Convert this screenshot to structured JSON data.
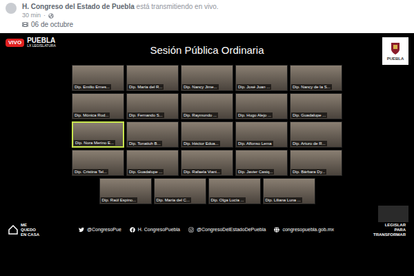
{
  "post": {
    "page": "H. Congreso del Estado de Puebla",
    "action": "está transmitiendo en vivo.",
    "time": "30 min",
    "separator": "·",
    "date": "06 de octubre"
  },
  "video": {
    "live_badge": "VIVO",
    "logo": {
      "name": "PUEBLA",
      "sub": "LX LEGISLATURA"
    },
    "title": "Sesión Pública Ordinaria",
    "crest_label": "PUEBLA",
    "participant_rows": [
      [
        {
          "name": "Dip. Emilio Ernes...",
          "speaking": false
        },
        {
          "name": "Dip. María del R...",
          "speaking": false
        },
        {
          "name": "Dip. Nancy Jime...",
          "speaking": false
        },
        {
          "name": "Dip. José Juan ...",
          "speaking": false
        },
        {
          "name": "Dip. Nancy de la S...",
          "speaking": false
        }
      ],
      [
        {
          "name": "Dip. Mónica Rod...",
          "speaking": false
        },
        {
          "name": "Dip. Fernando S...",
          "speaking": false
        },
        {
          "name": "Dip. Raymundo ...",
          "speaking": false
        },
        {
          "name": "Dip. Hugo Alejo ...",
          "speaking": false
        },
        {
          "name": "Dip. Guadalupe ...",
          "speaking": false
        }
      ],
      [
        {
          "name": "Dip. Nora Merino E...",
          "speaking": true
        },
        {
          "name": "Dip. Tonatiuh B...",
          "speaking": false
        },
        {
          "name": "Dip. Héctor Edua...",
          "speaking": false
        },
        {
          "name": "Dip. Alfonso Lema",
          "speaking": false
        },
        {
          "name": "Dip. Arturo de R...",
          "speaking": false
        }
      ],
      [
        {
          "name": "Dip. Cristina Tel...",
          "speaking": false
        },
        {
          "name": "Dip. Guadalupe ...",
          "speaking": false
        },
        {
          "name": "Dip. Rafaela Viani...",
          "speaking": false
        },
        {
          "name": "Dip. Javier Casiq...",
          "speaking": false
        },
        {
          "name": "Dip. Bárbara Dy...",
          "speaking": false
        }
      ],
      [
        {
          "name": "Dip. Raúl Espino...",
          "speaking": false
        },
        {
          "name": "Dip. María del C...",
          "speaking": false
        },
        {
          "name": "Dip. Olga Lucía ...",
          "speaking": false
        },
        {
          "name": "Dip. Liliana Luna ...",
          "speaking": false
        }
      ]
    ],
    "footer": {
      "campaign": [
        "ME",
        "QUEDO",
        "EN CASA"
      ],
      "links": [
        {
          "kind": "twitter",
          "label": "@CongresoPue"
        },
        {
          "kind": "facebook",
          "label": "H. CongresoPuebla"
        },
        {
          "kind": "instagram",
          "label": "@CongresoDelEstadoDePuebla"
        },
        {
          "kind": "web",
          "label": "congresopuebla.gob.mx"
        }
      ],
      "slogan": [
        "LEGISLAR",
        "PARA",
        "TRANSFORMAR"
      ]
    }
  }
}
